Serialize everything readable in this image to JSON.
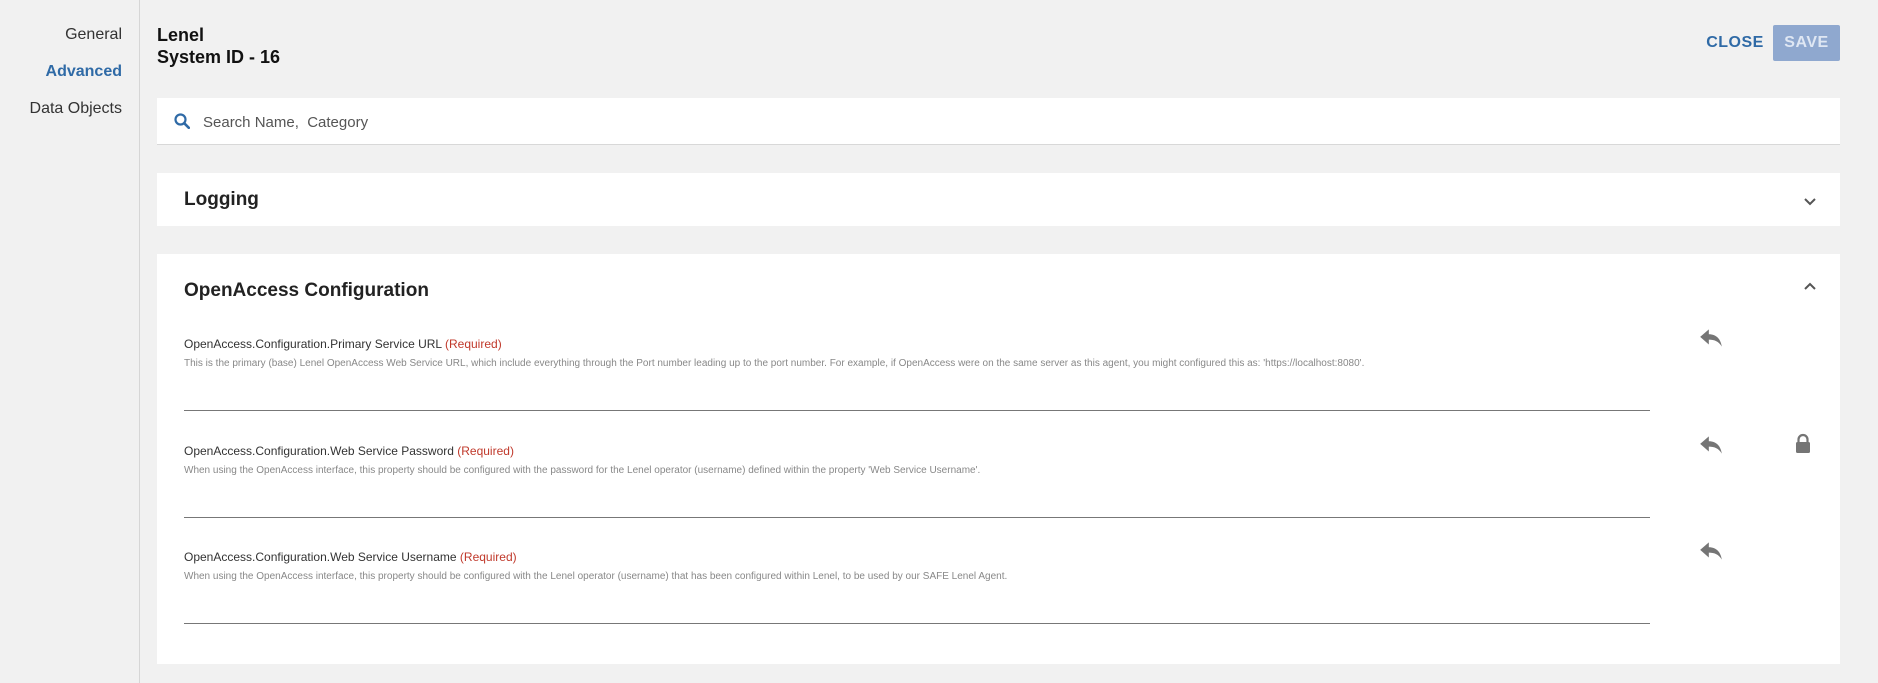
{
  "sidebar": {
    "items": [
      {
        "label": "General",
        "active": false
      },
      {
        "label": "Advanced",
        "active": true
      },
      {
        "label": "Data Objects",
        "active": false
      }
    ]
  },
  "header": {
    "title": "Lenel",
    "subtitle": "System ID - 16",
    "close_label": "CLOSE",
    "save_label": "SAVE"
  },
  "search": {
    "placeholder": "Search Name,  Category",
    "icon": "search-icon"
  },
  "sections": [
    {
      "title": "Logging",
      "expanded": false
    },
    {
      "title": "OpenAccess Configuration",
      "expanded": true,
      "properties": [
        {
          "name": "OpenAccess.Configuration.Primary Service URL",
          "required_label": "(Required)",
          "description": "This is the primary (base) Lenel OpenAccess Web Service URL, which include everything through the Port number leading up to the port number. For example, if OpenAccess were on the same server as this agent, you might configured this as: 'https://localhost:8080'.",
          "value": "",
          "locked": false
        },
        {
          "name": "OpenAccess.Configuration.Web Service Password",
          "required_label": "(Required)",
          "description": "When using the OpenAccess interface, this property should be configured with the password for the Lenel operator (username) defined within the property 'Web Service Username'.",
          "value": "",
          "locked": true
        },
        {
          "name": "OpenAccess.Configuration.Web Service Username",
          "required_label": "(Required)",
          "description": "When using the OpenAccess interface, this property should be configured with the Lenel operator (username) that has been configured within Lenel, to be used by our SAFE Lenel Agent.",
          "value": "",
          "locked": false
        }
      ]
    }
  ],
  "colors": {
    "accent": "#2f6aa6",
    "required": "#c0392b",
    "save_disabled": "#8fa8cf",
    "icon_gray": "#757575"
  }
}
